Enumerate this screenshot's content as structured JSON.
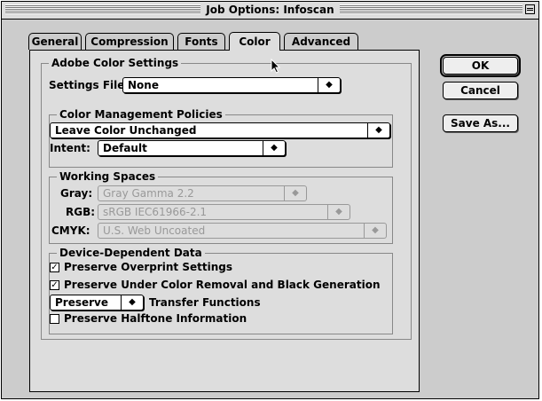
{
  "window": {
    "title": "Job Options: Infoscan"
  },
  "tabs": [
    {
      "label": "General"
    },
    {
      "label": "Compression"
    },
    {
      "label": "Fonts"
    },
    {
      "label": "Color",
      "active": true
    },
    {
      "label": "Advanced"
    }
  ],
  "adobe_color": {
    "title": "Adobe Color Settings",
    "settings_file_label": "Settings File:",
    "settings_file_value": "None"
  },
  "policies": {
    "title": "Color Management Policies",
    "policy_value": "Leave Color Unchanged",
    "intent_label": "Intent:",
    "intent_value": "Default"
  },
  "working_spaces": {
    "title": "Working Spaces",
    "gray_label": "Gray:",
    "gray_value": "Gray Gamma 2.2",
    "rgb_label": "RGB:",
    "rgb_value": "sRGB IEC61966-2.1",
    "cmyk_label": "CMYK:",
    "cmyk_value": "U.S. Web Uncoated"
  },
  "device_data": {
    "title": "Device-Dependent Data",
    "overprint_label": "Preserve Overprint Settings",
    "overprint_checked": true,
    "ucr_label": "Preserve Under Color Removal and Black Generation",
    "ucr_checked": true,
    "transfer_value": "Preserve",
    "transfer_label": "Transfer Functions",
    "halftone_label": "Preserve Halftone Information",
    "halftone_checked": false
  },
  "buttons": {
    "ok": "OK",
    "cancel": "Cancel",
    "save_as": "Save As..."
  },
  "glyphs": {
    "popup_arrows": "◆",
    "check": "✓"
  }
}
